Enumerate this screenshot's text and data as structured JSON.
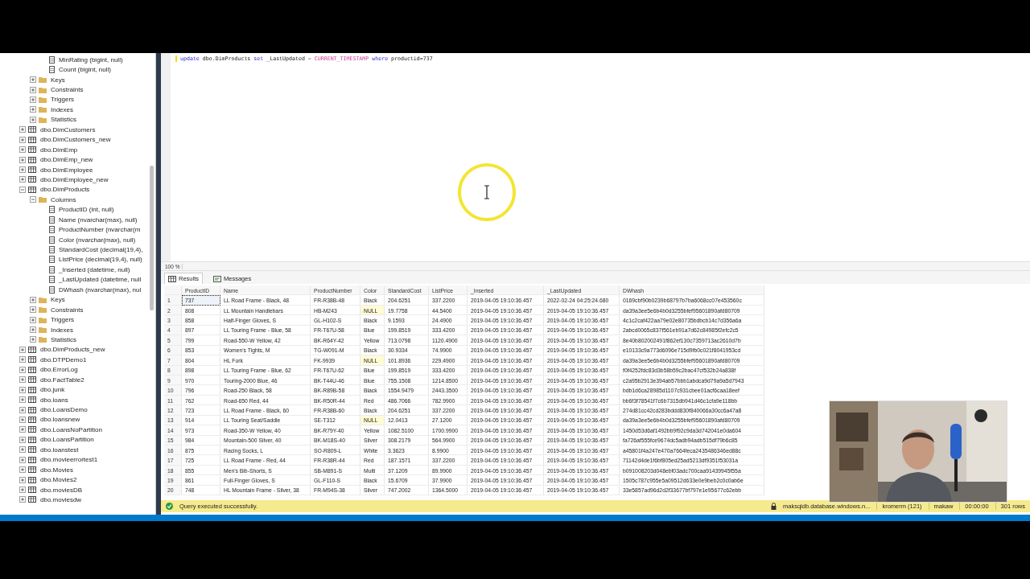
{
  "tree": [
    {
      "kind": "table",
      "children": [
        {
          "kind": "folder",
          "children": [
            {
              "kind": "column",
              "label": "MinRating (bigint, null)"
            },
            {
              "kind": "column",
              "label": "Count (bigint, null)"
            }
          ]
        },
        {
          "kind": "folder",
          "label": "Keys",
          "expanded": false
        },
        {
          "kind": "folder",
          "label": "Constraints",
          "expanded": false
        },
        {
          "kind": "folder",
          "label": "Triggers",
          "expanded": false
        },
        {
          "kind": "folder",
          "label": "Indexes",
          "expanded": false
        },
        {
          "kind": "folder",
          "label": "Statistics",
          "expanded": false
        }
      ]
    },
    {
      "kind": "table",
      "label": "dbo.DimCustomers",
      "expanded": false
    },
    {
      "kind": "table",
      "label": "dbo.DimCustomers_new",
      "expanded": false
    },
    {
      "kind": "table",
      "label": "dbo.DimEmp",
      "expanded": false
    },
    {
      "kind": "table",
      "label": "dbo.DimEmp_new",
      "expanded": false
    },
    {
      "kind": "table",
      "label": "dbo.DimEmployee",
      "expanded": false
    },
    {
      "kind": "table",
      "label": "dbo.DimEmployee_new",
      "expanded": false
    },
    {
      "kind": "table",
      "label": "dbo.DimProducts",
      "expanded": true,
      "children": [
        {
          "kind": "folder",
          "label": "Columns",
          "expanded": true,
          "children": [
            {
              "kind": "column",
              "label": "ProductID (int, null)"
            },
            {
              "kind": "column",
              "label": "Name (nvarchar(max), null)"
            },
            {
              "kind": "column",
              "label": "ProductNumber (nvarchar(m"
            },
            {
              "kind": "column",
              "label": "Color (nvarchar(max), null)"
            },
            {
              "kind": "column",
              "label": "StandardCost (decimal(19,4),"
            },
            {
              "kind": "column",
              "label": "ListPrice (decimal(19,4), null)"
            },
            {
              "kind": "column",
              "label": "_Inserted (datetime, null)"
            },
            {
              "kind": "column",
              "label": "_LastUpdated (datetime, null"
            },
            {
              "kind": "column",
              "label": "DWhash (nvarchar(max), nul"
            }
          ]
        },
        {
          "kind": "folder",
          "label": "Keys",
          "expanded": false
        },
        {
          "kind": "folder",
          "label": "Constraints",
          "expanded": false
        },
        {
          "kind": "folder",
          "label": "Triggers",
          "expanded": false
        },
        {
          "kind": "folder",
          "label": "Indexes",
          "expanded": false
        },
        {
          "kind": "folder",
          "label": "Statistics",
          "expanded": false
        }
      ]
    },
    {
      "kind": "table",
      "label": "dbo.DimProducts_new",
      "expanded": false
    },
    {
      "kind": "table",
      "label": "dbo.DTPDemo1",
      "expanded": false
    },
    {
      "kind": "table",
      "label": "dbo.ErrorLog",
      "expanded": false
    },
    {
      "kind": "table",
      "label": "dbo.FactTable2",
      "expanded": false
    },
    {
      "kind": "table",
      "label": "dbo.junk",
      "expanded": false
    },
    {
      "kind": "table",
      "label": "dbo.loans",
      "expanded": false
    },
    {
      "kind": "table",
      "label": "dbo.LoansDemo",
      "expanded": false
    },
    {
      "kind": "table",
      "label": "dbo.loansnew",
      "expanded": false
    },
    {
      "kind": "table",
      "label": "dbo.LoansNoPartition",
      "expanded": false
    },
    {
      "kind": "table",
      "label": "dbo.LoansPartition",
      "expanded": false
    },
    {
      "kind": "table",
      "label": "dbo.loanstest",
      "expanded": false
    },
    {
      "kind": "table",
      "label": "dbo.movieerrortest1",
      "expanded": false
    },
    {
      "kind": "table",
      "label": "dbo.Movies",
      "expanded": false
    },
    {
      "kind": "table",
      "label": "dbo.Movies2",
      "expanded": false
    },
    {
      "kind": "table",
      "label": "dbo.moviesDB",
      "expanded": false
    },
    {
      "kind": "table",
      "label": "dbo.moviesdw",
      "expanded": false
    }
  ],
  "editor": {
    "tokens": [
      {
        "kind": "keyword",
        "text": "update"
      },
      {
        "kind": "plain",
        "text": " dbo.DimProducts "
      },
      {
        "kind": "keyword",
        "text": "set"
      },
      {
        "kind": "plain",
        "text": " _LastUpdated "
      },
      {
        "kind": "operator",
        "text": "="
      },
      {
        "kind": "function",
        "text": " CURRENT_TIMESTAMP"
      },
      {
        "kind": "keyword",
        "text": " where"
      },
      {
        "kind": "plain",
        "text": " productid=737"
      }
    ],
    "zoom": "100 %"
  },
  "result_tabs": [
    {
      "label": "Results",
      "selected": true
    },
    {
      "label": "Messages",
      "selected": false
    }
  ],
  "grid": {
    "columns": [
      "ProductID",
      "Name",
      "ProductNumber",
      "Color",
      "StandardCost",
      "ListPrice",
      "_Inserted",
      "_LastUpdated",
      "DWhash"
    ],
    "rows": [
      {
        "number": "1",
        "selected": true,
        "cells": [
          "737",
          "LL Road Frame - Black, 48",
          "FR-R38B-48",
          "Black",
          "204.6251",
          "337.2200",
          "2019-04-05 19:10:36.457",
          "2022-02-24 04:25:24.680",
          "0169cbf90b0239b68797b7ba6068cc07e453560c"
        ]
      },
      {
        "number": "2",
        "selected": false,
        "cells": [
          "808",
          "LL Mountain Handlebars",
          "HB-M243",
          {
            "kind": "null",
            "text": "NULL"
          },
          "19.7758",
          "44.5400",
          "2019-04-05 19:10:36.457",
          "2019-04-05 19:10:36.457",
          "da39a3ee5e6b4b0d3255bfef95601890afd80709"
        ]
      },
      {
        "number": "3",
        "selected": false,
        "cells": [
          "858",
          "Half-Finger Gloves, S",
          "GL-H102-S",
          "Black",
          "9.1593",
          "24.4900",
          "2019-04-05 19:10:36.457",
          "2019-04-05 19:10:36.457",
          "4c1c2caf422aa79e02e80735bdbcb14c7d356a6a"
        ]
      },
      {
        "number": "4",
        "selected": false,
        "cells": [
          "897",
          "LL Touring Frame - Blue, 58",
          "FR-T67U-58",
          "Blue",
          "199.8519",
          "333.4200",
          "2019-04-05 19:10:36.457",
          "2019-04-05 19:10:36.457",
          "2abcd0065c837f561eb91a7d62c84985f2efc2c5"
        ]
      },
      {
        "number": "5",
        "selected": false,
        "cells": [
          "799",
          "Road-550-W Yellow, 42",
          "BK-R64Y-42",
          "Yellow",
          "713.0798",
          "1120.4900",
          "2019-04-05 19:10:36.457",
          "2019-04-05 19:10:36.457",
          "8e40b802002491f862ef130c7359713ac2610d7b"
        ]
      },
      {
        "number": "6",
        "selected": false,
        "cells": [
          "853",
          "Women's Tights, M",
          "TG-W091-M",
          "Black",
          "30.9334",
          "74.9900",
          "2019-04-05 19:10:36.457",
          "2019-04-05 19:10:36.457",
          "e10133c9a773d6096e715d9fb0c021f8041953cd"
        ]
      },
      {
        "number": "7",
        "selected": false,
        "cells": [
          "804",
          "HL Fork",
          "FK-9939",
          {
            "kind": "null",
            "text": "NULL"
          },
          "101.8936",
          "229.4900",
          "2019-04-05 19:10:36.457",
          "2019-04-05 19:10:36.457",
          "da39a3ee5e6b4b0d3255bfef95601890afd80709"
        ]
      },
      {
        "number": "8",
        "selected": false,
        "cells": [
          "898",
          "LL Touring Frame - Blue, 62",
          "FR-T67U-62",
          "Blue",
          "199.8519",
          "333.4200",
          "2019-04-05 19:10:36.457",
          "2019-04-05 19:10:36.457",
          "f0f4252fdc83d3b58b59c2bac47cf532b24a838f"
        ]
      },
      {
        "number": "9",
        "selected": false,
        "cells": [
          "970",
          "Touring-2000 Blue, 46",
          "BK-T44U-46",
          "Blue",
          "755.1508",
          "1214.8500",
          "2019-04-05 19:10:36.457",
          "2019-04-05 19:10:36.457",
          "c2a95b2913e394ab57bbb1abdca9d79a9a5d7943"
        ]
      },
      {
        "number": "10",
        "selected": false,
        "cells": [
          "796",
          "Road-250 Black, 58",
          "BK-R89B-58",
          "Black",
          "1554.9479",
          "2443.3500",
          "2019-04-05 19:10:36.457",
          "2019-04-05 19:10:36.457",
          "bdb1d6ca28985d1107c931cbee01acf6caa18eef"
        ]
      },
      {
        "number": "11",
        "selected": false,
        "cells": [
          "762",
          "Road-650 Red, 44",
          "BK-R50R-44",
          "Red",
          "486.7066",
          "782.9900",
          "2019-04-05 19:10:36.457",
          "2019-04-05 19:10:36.457",
          "bb6f3f78541f7c6b7315db941d46c1cfa9e118bb"
        ]
      },
      {
        "number": "12",
        "selected": false,
        "cells": [
          "723",
          "LL Road Frame - Black, 60",
          "FR-R38B-60",
          "Black",
          "204.6251",
          "337.2200",
          "2019-04-05 19:10:36.457",
          "2019-04-05 19:10:36.457",
          "274d81cc42cd283bddd830f840066a30cc6a47a8"
        ]
      },
      {
        "number": "13",
        "selected": false,
        "cells": [
          "914",
          "LL Touring Seat/Saddle",
          "SE-T312",
          {
            "kind": "null",
            "text": "NULL"
          },
          "12.0413",
          "27.1200",
          "2019-04-05 19:10:36.457",
          "2019-04-05 19:10:36.457",
          "da39a3ee5e6b4b0d3255bfef95601890afd80709"
        ]
      },
      {
        "number": "14",
        "selected": false,
        "cells": [
          "973",
          "Road-350-W Yellow, 40",
          "BK-R79Y-40",
          "Yellow",
          "1082.5100",
          "1700.9900",
          "2019-04-05 19:10:36.457",
          "2019-04-05 19:10:36.457",
          "1450d53d6af1492bb9f92c9da3d742041e0da604"
        ]
      },
      {
        "number": "15",
        "selected": false,
        "cells": [
          "984",
          "Mountain-500 Silver, 40",
          "BK-M18S-40",
          "Silver",
          "308.2179",
          "564.9900",
          "2019-04-05 19:10:36.457",
          "2019-04-05 19:10:36.457",
          "fa726af555fce9674dc5adb94adb515df79b6c85"
        ]
      },
      {
        "number": "16",
        "selected": false,
        "cells": [
          "875",
          "Racing Socks, L",
          "SO-R809-L",
          "White",
          "3.3623",
          "8.9900",
          "2019-04-05 19:10:36.457",
          "2019-04-05 19:10:36.457",
          "a45801f4a247e470a7664feca2435486346ed88c"
        ]
      },
      {
        "number": "17",
        "selected": false,
        "cells": [
          "725",
          "LL Road Frame - Red, 44",
          "FR-R38R-44",
          "Red",
          "187.1571",
          "337.2200",
          "2019-04-05 19:10:36.457",
          "2019-04-05 19:10:36.457",
          "71142d4de1f6bf805ed25ad5213df9351f53031a"
        ]
      },
      {
        "number": "18",
        "selected": false,
        "cells": [
          "855",
          "Men's Bib-Shorts, S",
          "SB-M891-S",
          "Multi",
          "37.1209",
          "89.9900",
          "2019-04-05 19:10:36.457",
          "2019-04-05 19:10:36.457",
          "b091008203d048ebf03adc700caa91439945f55a"
        ]
      },
      {
        "number": "19",
        "selected": false,
        "cells": [
          "861",
          "Full-Finger Gloves, S",
          "GL-F110-S",
          "Black",
          "15.6709",
          "37.9900",
          "2019-04-05 19:10:36.457",
          "2019-04-05 19:10:36.457",
          "1505c787c955e5a09512d633e0e9beb2c0c0ab6e"
        ]
      },
      {
        "number": "20",
        "selected": false,
        "cells": [
          "748",
          "HL Mountain Frame - Silver, 38",
          "FR-M94S-38",
          "Silver",
          "747.2002",
          "1364.5000",
          "2019-04-05 19:10:36.457",
          "2019-04-05 19:10:36.457",
          "33e5857ad96d2d2f33677bf797e1e95677c62ebb"
        ]
      }
    ]
  },
  "status_bar": {
    "message": "Query executed successfully.",
    "server": "maksqldb.database.windows.n...",
    "user": "kromerm (121)",
    "database": "makaw",
    "elapsed": "00:00:00",
    "rows": "301 rows"
  }
}
